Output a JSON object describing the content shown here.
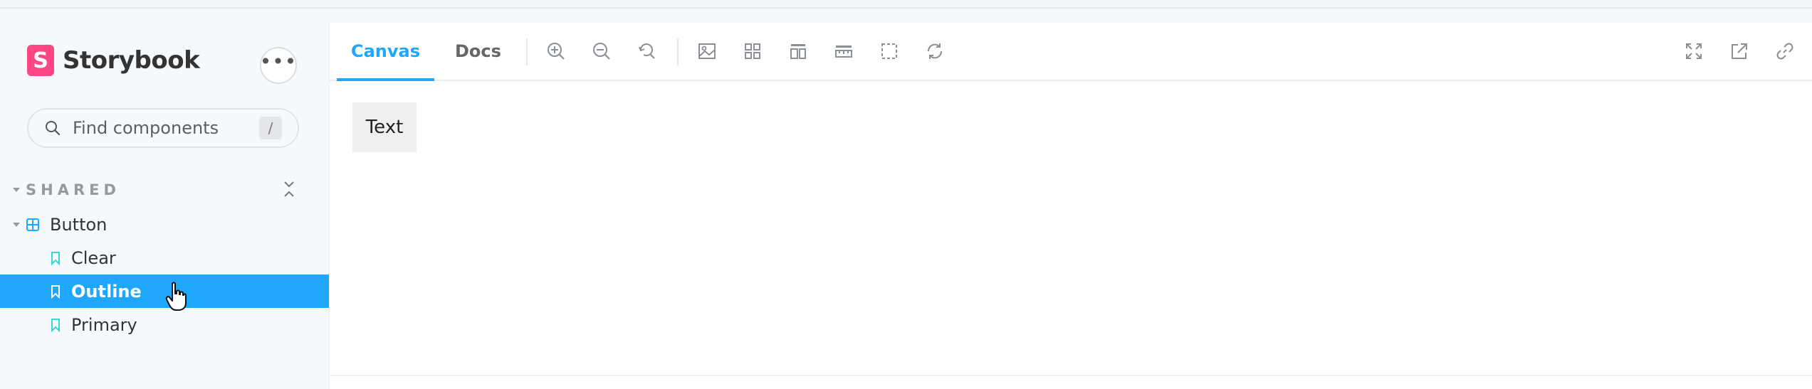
{
  "app": {
    "name": "Storybook",
    "logo_letter": "S"
  },
  "sidebar": {
    "more_label": "•••",
    "search": {
      "placeholder": "Find components",
      "shortcut": "/"
    },
    "section_label": "SHARED",
    "component": {
      "label": "Button"
    },
    "stories": [
      {
        "label": "Clear",
        "selected": false
      },
      {
        "label": "Outline",
        "selected": true
      },
      {
        "label": "Primary",
        "selected": false
      }
    ]
  },
  "toolbar": {
    "tabs": [
      {
        "label": "Canvas",
        "active": true
      },
      {
        "label": "Docs",
        "active": false
      }
    ],
    "tools": [
      "zoom-in-icon",
      "zoom-out-icon",
      "reset-zoom-icon",
      "background-icon",
      "grid-icon",
      "viewport-icon",
      "measure-icon",
      "outline-icon",
      "remount-icon"
    ],
    "right_tools": [
      "fullscreen-icon",
      "open-new-tab-icon",
      "copy-link-icon"
    ]
  },
  "preview": {
    "button_label": "Text"
  },
  "colors": {
    "accent": "#1ea7fd",
    "brand": "#ff4785",
    "sidebar_bg": "#f6f9fc"
  }
}
